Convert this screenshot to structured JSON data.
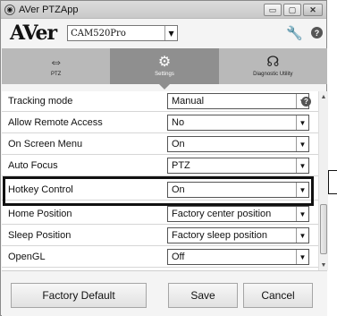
{
  "window": {
    "title": "AVer PTZApp",
    "minimize": "▭",
    "maximize": "▢",
    "close": "✕"
  },
  "brand": {
    "logo": "AVer",
    "camera_model": "CAM520Pro",
    "tool_icon": "🔧",
    "help_icon": "?"
  },
  "tabs": [
    {
      "icon": "ptz-icon",
      "glyph": "⇔",
      "label": "PTZ"
    },
    {
      "icon": "gear-icon",
      "glyph": "⚙",
      "label": "Settings"
    },
    {
      "icon": "stethoscope-icon",
      "glyph": "☊",
      "label": "Diagnostic Utility"
    }
  ],
  "active_tab": "Settings",
  "settings": [
    {
      "label": "Tracking mode",
      "value": "Manual",
      "has_info": true
    },
    {
      "label": "Allow Remote Access",
      "value": "No"
    },
    {
      "label": "On Screen Menu",
      "value": "On"
    },
    {
      "label": "Auto Focus",
      "value": "PTZ"
    },
    {
      "label": "Hotkey Control",
      "value": "On"
    },
    {
      "label": "Home Position",
      "value": "Factory center position"
    },
    {
      "label": "Sleep Position",
      "value": "Factory sleep position"
    },
    {
      "label": "OpenGL",
      "value": "Off"
    }
  ],
  "footer": {
    "factory_default": "Factory Default",
    "save": "Save",
    "cancel": "Cancel"
  },
  "colors": {
    "tab_bg": "#b9b9b9",
    "tab_active_bg": "#8f8f8f"
  }
}
